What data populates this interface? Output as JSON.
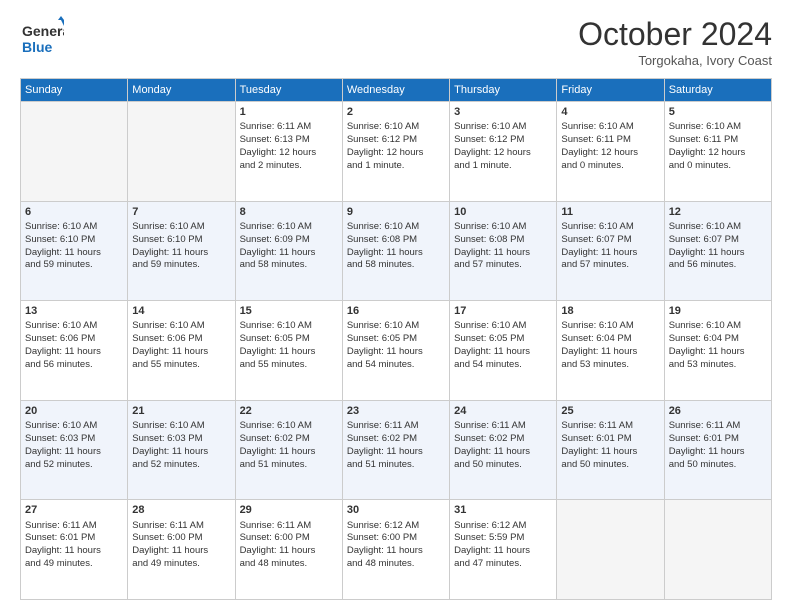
{
  "header": {
    "logo_line1": "General",
    "logo_line2": "Blue",
    "title": "October 2024",
    "location": "Torgokaha, Ivory Coast"
  },
  "weekdays": [
    "Sunday",
    "Monday",
    "Tuesday",
    "Wednesday",
    "Thursday",
    "Friday",
    "Saturday"
  ],
  "weeks": [
    [
      {
        "day": "",
        "info": ""
      },
      {
        "day": "",
        "info": ""
      },
      {
        "day": "1",
        "info": "Sunrise: 6:11 AM\nSunset: 6:13 PM\nDaylight: 12 hours\nand 2 minutes."
      },
      {
        "day": "2",
        "info": "Sunrise: 6:10 AM\nSunset: 6:12 PM\nDaylight: 12 hours\nand 1 minute."
      },
      {
        "day": "3",
        "info": "Sunrise: 6:10 AM\nSunset: 6:12 PM\nDaylight: 12 hours\nand 1 minute."
      },
      {
        "day": "4",
        "info": "Sunrise: 6:10 AM\nSunset: 6:11 PM\nDaylight: 12 hours\nand 0 minutes."
      },
      {
        "day": "5",
        "info": "Sunrise: 6:10 AM\nSunset: 6:11 PM\nDaylight: 12 hours\nand 0 minutes."
      }
    ],
    [
      {
        "day": "6",
        "info": "Sunrise: 6:10 AM\nSunset: 6:10 PM\nDaylight: 11 hours\nand 59 minutes."
      },
      {
        "day": "7",
        "info": "Sunrise: 6:10 AM\nSunset: 6:10 PM\nDaylight: 11 hours\nand 59 minutes."
      },
      {
        "day": "8",
        "info": "Sunrise: 6:10 AM\nSunset: 6:09 PM\nDaylight: 11 hours\nand 58 minutes."
      },
      {
        "day": "9",
        "info": "Sunrise: 6:10 AM\nSunset: 6:08 PM\nDaylight: 11 hours\nand 58 minutes."
      },
      {
        "day": "10",
        "info": "Sunrise: 6:10 AM\nSunset: 6:08 PM\nDaylight: 11 hours\nand 57 minutes."
      },
      {
        "day": "11",
        "info": "Sunrise: 6:10 AM\nSunset: 6:07 PM\nDaylight: 11 hours\nand 57 minutes."
      },
      {
        "day": "12",
        "info": "Sunrise: 6:10 AM\nSunset: 6:07 PM\nDaylight: 11 hours\nand 56 minutes."
      }
    ],
    [
      {
        "day": "13",
        "info": "Sunrise: 6:10 AM\nSunset: 6:06 PM\nDaylight: 11 hours\nand 56 minutes."
      },
      {
        "day": "14",
        "info": "Sunrise: 6:10 AM\nSunset: 6:06 PM\nDaylight: 11 hours\nand 55 minutes."
      },
      {
        "day": "15",
        "info": "Sunrise: 6:10 AM\nSunset: 6:05 PM\nDaylight: 11 hours\nand 55 minutes."
      },
      {
        "day": "16",
        "info": "Sunrise: 6:10 AM\nSunset: 6:05 PM\nDaylight: 11 hours\nand 54 minutes."
      },
      {
        "day": "17",
        "info": "Sunrise: 6:10 AM\nSunset: 6:05 PM\nDaylight: 11 hours\nand 54 minutes."
      },
      {
        "day": "18",
        "info": "Sunrise: 6:10 AM\nSunset: 6:04 PM\nDaylight: 11 hours\nand 53 minutes."
      },
      {
        "day": "19",
        "info": "Sunrise: 6:10 AM\nSunset: 6:04 PM\nDaylight: 11 hours\nand 53 minutes."
      }
    ],
    [
      {
        "day": "20",
        "info": "Sunrise: 6:10 AM\nSunset: 6:03 PM\nDaylight: 11 hours\nand 52 minutes."
      },
      {
        "day": "21",
        "info": "Sunrise: 6:10 AM\nSunset: 6:03 PM\nDaylight: 11 hours\nand 52 minutes."
      },
      {
        "day": "22",
        "info": "Sunrise: 6:10 AM\nSunset: 6:02 PM\nDaylight: 11 hours\nand 51 minutes."
      },
      {
        "day": "23",
        "info": "Sunrise: 6:11 AM\nSunset: 6:02 PM\nDaylight: 11 hours\nand 51 minutes."
      },
      {
        "day": "24",
        "info": "Sunrise: 6:11 AM\nSunset: 6:02 PM\nDaylight: 11 hours\nand 50 minutes."
      },
      {
        "day": "25",
        "info": "Sunrise: 6:11 AM\nSunset: 6:01 PM\nDaylight: 11 hours\nand 50 minutes."
      },
      {
        "day": "26",
        "info": "Sunrise: 6:11 AM\nSunset: 6:01 PM\nDaylight: 11 hours\nand 50 minutes."
      }
    ],
    [
      {
        "day": "27",
        "info": "Sunrise: 6:11 AM\nSunset: 6:01 PM\nDaylight: 11 hours\nand 49 minutes."
      },
      {
        "day": "28",
        "info": "Sunrise: 6:11 AM\nSunset: 6:00 PM\nDaylight: 11 hours\nand 49 minutes."
      },
      {
        "day": "29",
        "info": "Sunrise: 6:11 AM\nSunset: 6:00 PM\nDaylight: 11 hours\nand 48 minutes."
      },
      {
        "day": "30",
        "info": "Sunrise: 6:12 AM\nSunset: 6:00 PM\nDaylight: 11 hours\nand 48 minutes."
      },
      {
        "day": "31",
        "info": "Sunrise: 6:12 AM\nSunset: 5:59 PM\nDaylight: 11 hours\nand 47 minutes."
      },
      {
        "day": "",
        "info": ""
      },
      {
        "day": "",
        "info": ""
      }
    ]
  ]
}
